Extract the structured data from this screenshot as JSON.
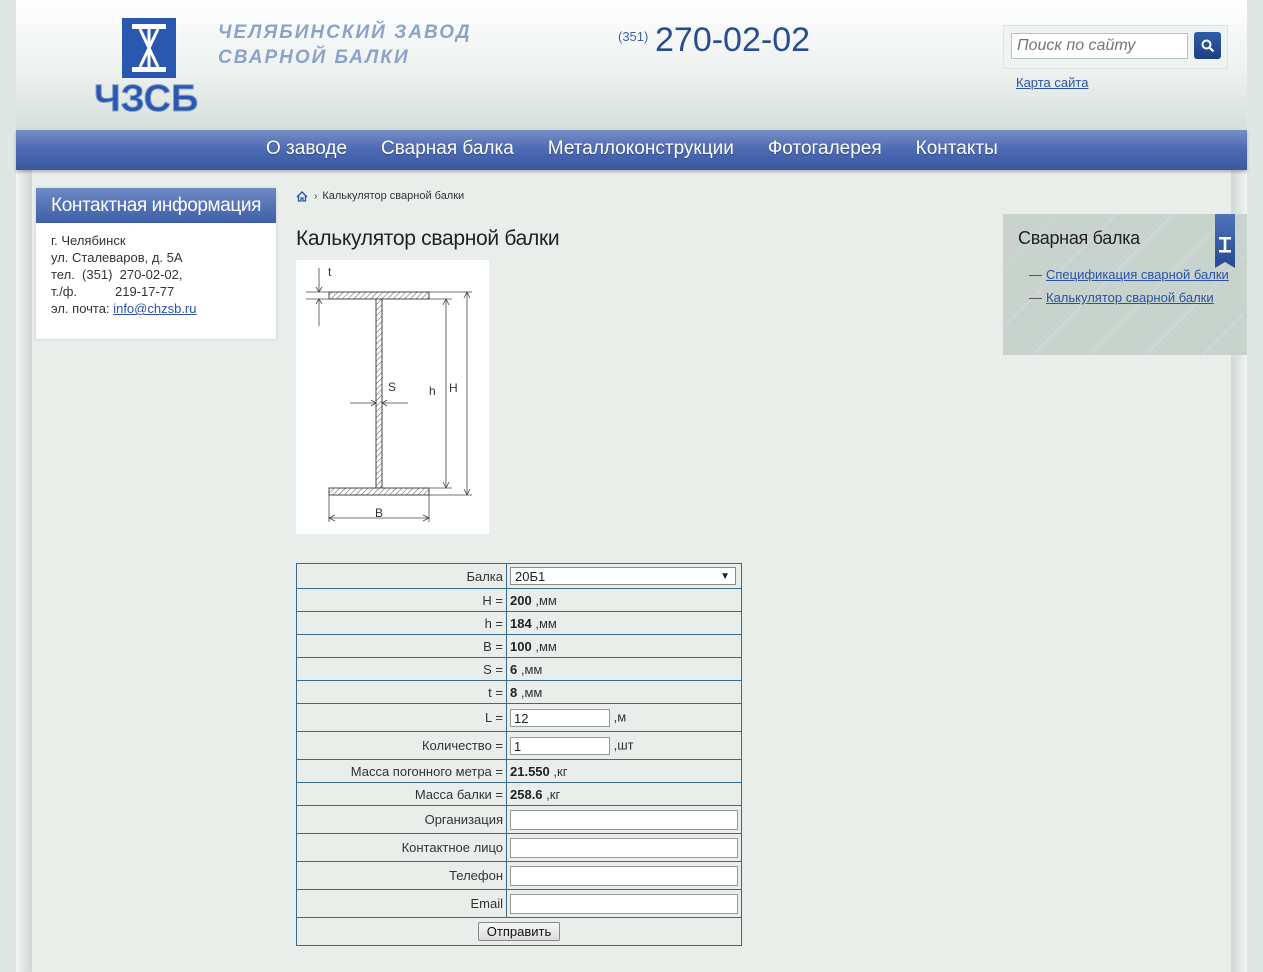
{
  "header": {
    "logo_text": "ЧЗСБ",
    "brand_line1": "Челябинский завод",
    "brand_line2": "сварной балки",
    "phone_code": "(351)",
    "phone": "270-02-02",
    "search_placeholder": "Поиск по сайту",
    "sitemap_link": "Карта сайта"
  },
  "nav": {
    "items": [
      "О заводе",
      "Сварная балка",
      "Металлоконструкции",
      "Фотогалерея",
      "Контакты"
    ]
  },
  "contact": {
    "title": "Контактная информация",
    "city": "г. Челябинск",
    "street": "ул. Сталеваров, д. 5А",
    "phone_label": "тел.",
    "phone_value": "(351)  270-02-02,",
    "fax_label": "т./ф.",
    "fax_value": "219-17-77",
    "email_label": "эл. почта:",
    "email": "info@chzsb.ru"
  },
  "breadcrumb": {
    "current": "Калькулятор сварной балки"
  },
  "page_title": "Калькулятор сварной балки",
  "diagram": {
    "labels": [
      "t",
      "S",
      "h",
      "H",
      "B"
    ]
  },
  "calc": {
    "beam_label": "Балка",
    "beam_value": "20Б1",
    "H_label": "H =",
    "H_value": "200",
    "h_label": "h =",
    "h_value": "184",
    "B_label": "B =",
    "B_value": "100",
    "S_label": "S =",
    "S_value": "6",
    "t_label": "t =",
    "t_value": "8",
    "mm_unit": ",мм",
    "L_label": "L =",
    "L_value": "12",
    "L_unit": ",м",
    "qty_label": "Количество =",
    "qty_value": "1",
    "qty_unit": ",шт",
    "mass_m_label": "Масса погонного метра =",
    "mass_m_value": "21.550",
    "mass_unit": ",кг",
    "mass_b_label": "Масса балки =",
    "mass_b_value": "258.6",
    "org_label": "Организация",
    "contact_label": "Контактное лицо",
    "tel_label": "Телефон",
    "email_label": "Email",
    "submit_label": "Отправить"
  },
  "sidebar_right": {
    "title": "Сварная балка",
    "links": [
      "Спецификация сварной балки",
      "Калькулятор сварной балки"
    ]
  },
  "colors": {
    "nav": "#4e6cb4",
    "link": "#2a52a8",
    "phone": "#284d8f",
    "brand": "#8aa3c9"
  }
}
